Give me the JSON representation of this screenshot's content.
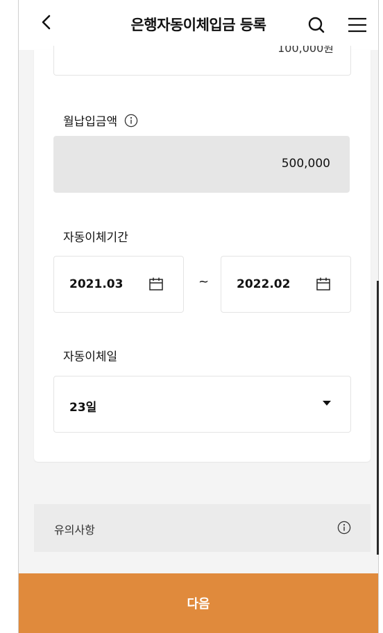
{
  "header": {
    "title": "은행자동이체입금 등록",
    "back_icon": "chevron-left-icon",
    "search_icon": "search-icon",
    "menu_icon": "hamburger-menu-icon"
  },
  "form": {
    "prev_amount_partial": "100,000원",
    "monthly_deposit": {
      "label": "월납입금액",
      "info_icon": "info-circle-icon",
      "value": "500,000"
    },
    "transfer_period": {
      "label": "자동이체기간",
      "start": "2021.03",
      "separator": "~",
      "end": "2022.02",
      "calendar_icon": "calendar-icon"
    },
    "transfer_day": {
      "label": "자동이체일",
      "value": "23일",
      "dropdown_icon": "caret-down-icon"
    }
  },
  "notice": {
    "label": "유의사항",
    "info_icon": "info-circle-icon"
  },
  "footer": {
    "next_label": "다음"
  },
  "colors": {
    "accent": "#e08a3c",
    "readonly_field": "#e6e6e6",
    "page_background": "#f4f4f4"
  }
}
